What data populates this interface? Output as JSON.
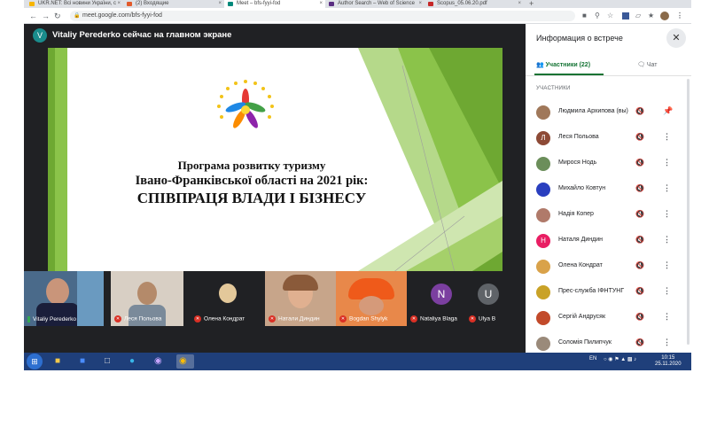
{
  "browser": {
    "tabs": [
      {
        "label": "UKR.NET: Всі новини України, с",
        "active": false,
        "favicon_color": "#f7b500"
      },
      {
        "label": "(2) Входящие",
        "active": false,
        "favicon_color": "#e25a2b"
      },
      {
        "label": "Meet – bfs-fyyi-fod",
        "active": true,
        "favicon_color": "#00897b"
      },
      {
        "label": "Author Search – Web of Science",
        "active": false,
        "favicon_color": "#5a2d82"
      },
      {
        "label": "Scopus_05.06.20.pdf",
        "active": false,
        "favicon_color": "#c62828"
      }
    ],
    "close_glyph": "×",
    "new_tab_glyph": "+",
    "url": "meet.google.com/bfs-fyyi-fod"
  },
  "meet": {
    "presenter_initial": "V",
    "presenter_text": "Vitaliy Perederko сейчас на главном экране",
    "slide": {
      "line1": "Програма розвитку туризму",
      "line2": "Івано-Франківської області на 2021 рік:",
      "line3": "СПІВПРАЦЯ ВЛАДИ І БІЗНЕСУ"
    },
    "tiles": [
      {
        "name": "Vitaliy Perederko",
        "muted": false
      },
      {
        "name": "Леся Польова",
        "muted": true
      },
      {
        "name": "Олена Кондрат",
        "muted": true
      },
      {
        "name": "Натали Диндин",
        "muted": true
      },
      {
        "name": "Bogdan Shylyk",
        "muted": true
      },
      {
        "name": "Nataliya Blaga",
        "muted": true,
        "initial": "N",
        "color": "#7b3fa0"
      },
      {
        "name": "Ulya B",
        "muted": true,
        "initial": "U",
        "color": "#5f6368"
      }
    ]
  },
  "panel": {
    "title": "Информация о встрече",
    "tab_participants": "Участники (22)",
    "tab_chat": "Чат",
    "section": "УЧАСТНИКИ",
    "participants": [
      {
        "name": "Людмила Архипова (вы)",
        "initial": "",
        "color": "#a0785a"
      },
      {
        "name": "Леся Польова",
        "initial": "Л",
        "color": "#8d4a36"
      },
      {
        "name": "Мирося Нодь",
        "initial": "",
        "color": "#6b8e5a"
      },
      {
        "name": "Михайло Ковтун",
        "initial": "",
        "color": "#2a3fbf"
      },
      {
        "name": "Надія Копер",
        "initial": "",
        "color": "#b07a6a"
      },
      {
        "name": "Наталя Диндин",
        "initial": "Н",
        "color": "#e91e63"
      },
      {
        "name": "Олена Кондрат",
        "initial": "",
        "color": "#d9a24a"
      },
      {
        "name": "Прес-служба ІФНТУНГ",
        "initial": "",
        "color": "#c9a227"
      },
      {
        "name": "Сергій Андрусяк",
        "initial": "",
        "color": "#c24a2a"
      },
      {
        "name": "Соломія Пилипчук",
        "initial": "",
        "color": "#9a8a7a"
      }
    ]
  },
  "taskbar": {
    "lang": "EN",
    "time": "10:15",
    "date": "25.11.2020"
  }
}
